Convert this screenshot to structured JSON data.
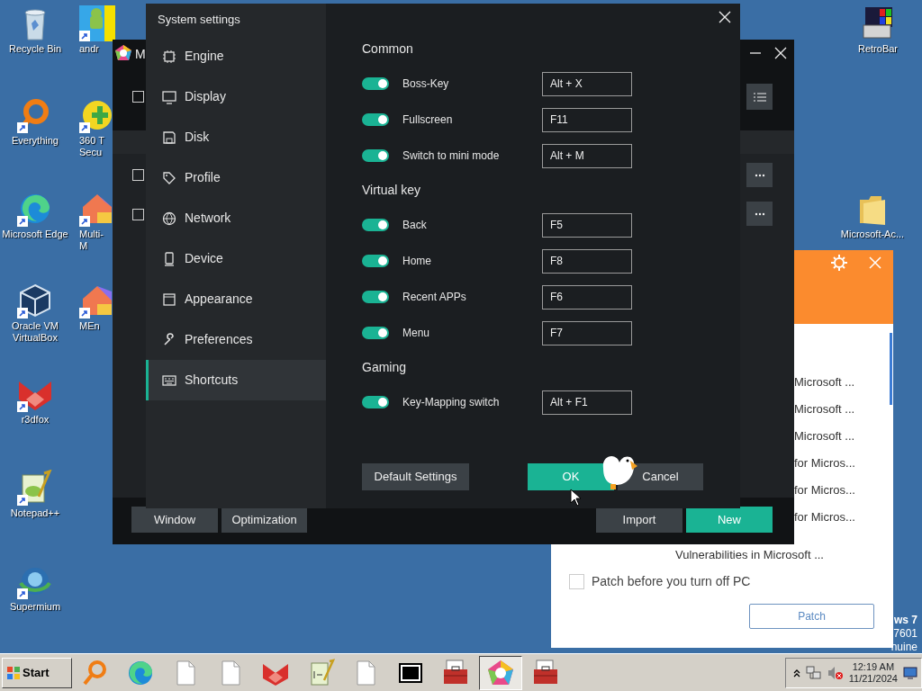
{
  "desktop_icons": [
    {
      "kind": "recycle",
      "label": "Recycle Bin",
      "shortcut": false
    },
    {
      "kind": "everything",
      "label": "Everything",
      "shortcut": true
    },
    {
      "kind": "edge",
      "label": "Microsoft Edge",
      "shortcut": true
    },
    {
      "kind": "virtualbox",
      "label": "Oracle VM VirtualBox",
      "shortcut": true
    },
    {
      "kind": "r3dfox",
      "label": "r3dfox",
      "shortcut": true
    },
    {
      "kind": "notepad",
      "label": "Notepad++",
      "shortcut": true
    },
    {
      "kind": "supermium",
      "label": "Supermium",
      "shortcut": true
    },
    {
      "kind": "android",
      "label": "andr",
      "shortcut": true
    },
    {
      "kind": "shield",
      "label": "360 T Secu",
      "shortcut": true
    },
    {
      "kind": "multi",
      "label": "Multi-M",
      "shortcut": true
    },
    {
      "kind": "memu",
      "label": "MEn",
      "shortcut": true
    },
    {
      "kind": "retrobar",
      "label": "RetroBar",
      "shortcut": false
    },
    {
      "kind": "folder",
      "label": "Microsoft-Ac...",
      "shortcut": false
    }
  ],
  "patch_window": {
    "rows": [
      "Microsoft ...",
      "Microsoft ...",
      "Microsoft ...",
      "for Micros...",
      "for Micros...",
      "for Micros...",
      "Vulnerabilities in Microsoft ..."
    ],
    "auto_patch": {
      "label": "Patch before you turn off PC",
      "checked": false
    },
    "button": "Patch"
  },
  "os_notice": [
    "ws 7",
    "7601",
    "nuine"
  ],
  "main_window": {
    "title": "M",
    "row_checks": [
      {
        "checked": false
      },
      {
        "checked": false
      },
      {
        "checked": false
      }
    ],
    "buttons": [
      {
        "label": "Window",
        "kind": "secondary"
      },
      {
        "label": "Optimization",
        "kind": "secondary"
      },
      {
        "label": "Import",
        "kind": "secondary"
      },
      {
        "label": "New",
        "kind": "primary"
      }
    ]
  },
  "settings": {
    "title": "System settings",
    "nav": [
      {
        "label": "Engine",
        "kind": "chip",
        "selected": false
      },
      {
        "label": "Display",
        "kind": "monitor",
        "selected": false
      },
      {
        "label": "Disk",
        "kind": "disk",
        "selected": false
      },
      {
        "label": "Profile",
        "kind": "tag",
        "selected": false
      },
      {
        "label": "Network",
        "kind": "globe",
        "selected": false
      },
      {
        "label": "Device",
        "kind": "phone",
        "selected": false
      },
      {
        "label": "Appearance",
        "kind": "window",
        "selected": false
      },
      {
        "label": "Preferences",
        "kind": "wrench",
        "selected": false
      },
      {
        "label": "Shortcuts",
        "kind": "keyboard",
        "selected": true
      }
    ],
    "sections": [
      {
        "title": "Common",
        "rows": [
          {
            "label": "Boss-Key",
            "on": true,
            "shortcut": "Alt + X"
          },
          {
            "label": "Fullscreen",
            "on": true,
            "shortcut": "F11"
          },
          {
            "label": "Switch to mini mode",
            "on": true,
            "shortcut": "Alt + M"
          }
        ]
      },
      {
        "title": "Virtual key",
        "rows": [
          {
            "label": "Back",
            "on": true,
            "shortcut": "F5"
          },
          {
            "label": "Home",
            "on": true,
            "shortcut": "F8"
          },
          {
            "label": "Recent APPs",
            "on": true,
            "shortcut": "F6"
          },
          {
            "label": "Menu",
            "on": true,
            "shortcut": "F7"
          }
        ]
      },
      {
        "title": "Gaming",
        "rows": [
          {
            "label": "Key-Mapping switch",
            "on": true,
            "shortcut": "Alt + F1"
          }
        ]
      }
    ],
    "buttons": [
      {
        "label": "Default Settings",
        "kind": "secondary"
      },
      {
        "label": "OK",
        "kind": "primary"
      },
      {
        "label": "Cancel",
        "kind": "secondary"
      }
    ]
  },
  "taskbar": {
    "start": "Start",
    "apps": [
      {
        "kind": "search",
        "selected": false
      },
      {
        "kind": "edge",
        "selected": false
      },
      {
        "kind": "doc",
        "selected": false
      },
      {
        "kind": "doc",
        "selected": false
      },
      {
        "kind": "r3dfox",
        "selected": false
      },
      {
        "kind": "notepad",
        "selected": false
      },
      {
        "kind": "doc",
        "selected": false
      },
      {
        "kind": "archive",
        "selected": false
      },
      {
        "kind": "toolbox",
        "selected": false
      },
      {
        "kind": "memu",
        "selected": true
      },
      {
        "kind": "toolbox",
        "selected": false
      }
    ],
    "time": "12:19 AM",
    "date": "11/21/2024"
  }
}
